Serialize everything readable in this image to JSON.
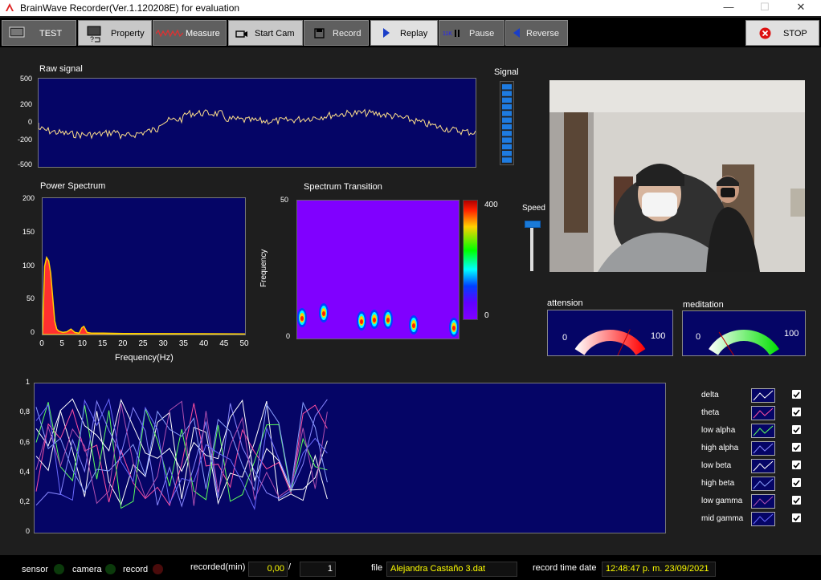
{
  "window": {
    "title": "BrainWave Recorder(Ver.1.120208E) for evaluation",
    "min": "—",
    "max": "☐",
    "close": "✕"
  },
  "toolbar": {
    "test": "TEST",
    "property": "Property",
    "measure": "Measure",
    "start_cam": "Start Cam",
    "record": "Record",
    "replay": "Replay",
    "pause": "Pause",
    "reverse": "Reverse",
    "stop": "STOP"
  },
  "raw_signal": {
    "title": "Raw signal",
    "yticks": [
      "500",
      "200",
      "0",
      "-200",
      "-500"
    ]
  },
  "signal_meter": {
    "title": "Signal"
  },
  "power_spectrum": {
    "title": "Power Spectrum",
    "yticks": [
      "200",
      "150",
      "100",
      "50",
      "0"
    ],
    "xticks": [
      "0",
      "5",
      "10",
      "15",
      "20",
      "25",
      "30",
      "35",
      "40",
      "45",
      "50"
    ],
    "xlabel": "Frequency(Hz)"
  },
  "spectrum_transition": {
    "title": "Spectrum Transition",
    "ylabel": "Frequency",
    "ytick_top": "50",
    "ytick_bottom": "0",
    "scale_max": "400",
    "scale_min": "0"
  },
  "speed": {
    "label": "Speed",
    "value": 1.0
  },
  "attension": {
    "label": "attension",
    "min": "0",
    "max": "100",
    "value": 72
  },
  "meditation": {
    "label": "meditation",
    "min": "0",
    "max": "100",
    "value": 22
  },
  "bands_chart": {
    "yticks": [
      "1",
      "0,8",
      "0,6",
      "0,4",
      "0,2",
      "0"
    ]
  },
  "legend": [
    {
      "name": "delta",
      "color": "#ffffff",
      "checked": true
    },
    {
      "name": "theta",
      "color": "#ff4fa0",
      "checked": true
    },
    {
      "name": "low alpha",
      "color": "#5cff5c",
      "checked": true
    },
    {
      "name": "high alpha",
      "color": "#8888ff",
      "checked": true
    },
    {
      "name": "low beta",
      "color": "#ffffff",
      "checked": true
    },
    {
      "name": "high beta",
      "color": "#8aa0ff",
      "checked": true
    },
    {
      "name": "low gamma",
      "color": "#b050b0",
      "checked": true
    },
    {
      "name": "mid gamma",
      "color": "#6a6aff",
      "checked": true
    }
  ],
  "status": {
    "sensor": "sensor",
    "camera": "camera",
    "record": "record",
    "recorded_label": "recorded(min)",
    "recorded_value": "0,00",
    "slash": "/",
    "total_value": "1",
    "file_label": "file",
    "file_value": "Alejandra Castaño 3.dat",
    "time_label": "record time date",
    "time_value": "12:48:47 p. m. 23/09/2021"
  },
  "colors": {
    "plot_bg": "#050566",
    "spectrum_bg": "#8000ff",
    "raw_line": "#ffe08a"
  }
}
